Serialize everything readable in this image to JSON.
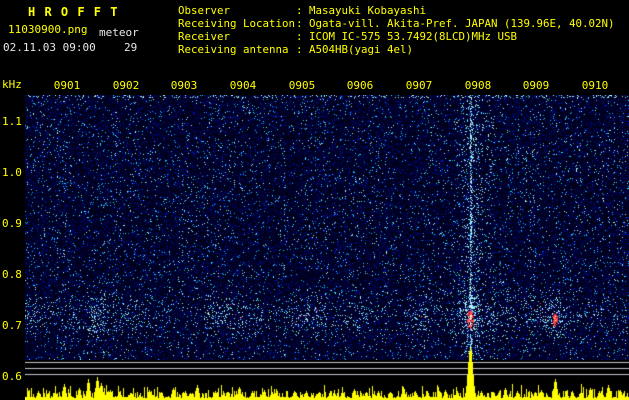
{
  "header": {
    "app_title": "H R O F F T",
    "filename": "11030900.png",
    "mode_label": "meteor",
    "datetime": "02.11.03 09:00",
    "echo_count": "29",
    "info": [
      {
        "label": "Observer",
        "value": ": Masayuki Kobayashi"
      },
      {
        "label": "Receiving Location",
        "value": ": Ogata-vill. Akita-Pref. JAPAN (139.96E, 40.02N)"
      },
      {
        "label": "Receiver",
        "value": ": ICOM IC-575 53.7492(8LCD)MHz USB"
      },
      {
        "label": "Receiving antenna",
        "value": ": A504HB(yagi 4el)"
      }
    ]
  },
  "axes": {
    "freq_labels": [
      "kHz",
      "1.1",
      "1.0",
      "0.9",
      "0.8",
      "0.7",
      "0.6"
    ],
    "time_labels": [
      "0901",
      "0902",
      "0903",
      "0904",
      "0905",
      "0906",
      "0907",
      "0908",
      "0909",
      "0910"
    ]
  },
  "chart_data": {
    "type": "heatmap",
    "subtype": "radio-meteor-spectrogram waterfall with amplitude strip below",
    "title": "HROFFT 10-minute meteor echo spectrogram, 02.11.03 09:00-09:10",
    "x_ticks": [
      "0901",
      "0902",
      "0903",
      "0904",
      "0905",
      "0906",
      "0907",
      "0908",
      "0909",
      "0910"
    ],
    "y_unit": "kHz",
    "y_ticks_khz": [
      1.1,
      1.0,
      0.9,
      0.8,
      0.7,
      0.6
    ],
    "y_range_khz": [
      0.6,
      1.16
    ],
    "echo_count": 29,
    "carrier_band_khz": 0.72,
    "meteor_echoes": [
      {
        "time": "~0901.6",
        "freq_khz": 0.72,
        "strength": "weak",
        "note": "small cyan cluster with faint red dots, small amplitude spike"
      },
      {
        "time": "~0908.0",
        "freq_khz": 0.72,
        "strength": "strong",
        "note": "overdense long echo: full-height cyan streak, saturated red/white core, large yellow amplitude spike"
      },
      {
        "time": "~0909.5",
        "freq_khz": 0.74,
        "strength": "moderate",
        "note": "cyan blob with red streak, medium amplitude spike"
      }
    ],
    "colors": {
      "background": "#000010",
      "noise_blue": "#0030a0",
      "speckle_cyan": "#00ccff",
      "hot_core": "#ff2050",
      "amplitude_spike": "#ffff00",
      "text_yellow": "#ffff00",
      "text_white": "#e8e8e8",
      "level_line": "#c0c4cc"
    }
  },
  "render": {
    "seed": 20021103,
    "band_y": 220,
    "level_lines": [
      17,
      23,
      29
    ],
    "events": [
      {
        "x_frac": 0.119,
        "blob": 0.7,
        "red": 0.5,
        "streak": false,
        "spike": 23
      },
      {
        "x_frac": 0.737,
        "blob": 1.0,
        "red": 1.0,
        "streak": true,
        "spike": 53
      },
      {
        "x_frac": 0.877,
        "blob": 0.85,
        "red": 0.75,
        "streak": false,
        "spike": 21
      }
    ],
    "minor_spikes": [
      [
        0.022,
        9
      ],
      [
        0.048,
        7
      ],
      [
        0.065,
        16
      ],
      [
        0.09,
        12
      ],
      [
        0.105,
        21
      ],
      [
        0.125,
        17
      ],
      [
        0.14,
        10
      ],
      [
        0.155,
        8
      ],
      [
        0.175,
        7
      ],
      [
        0.205,
        10
      ],
      [
        0.225,
        8
      ],
      [
        0.245,
        12
      ],
      [
        0.265,
        9
      ],
      [
        0.285,
        15
      ],
      [
        0.315,
        9
      ],
      [
        0.335,
        8
      ],
      [
        0.355,
        13
      ],
      [
        0.375,
        9
      ],
      [
        0.395,
        10
      ],
      [
        0.415,
        8
      ],
      [
        0.445,
        9
      ],
      [
        0.465,
        9
      ],
      [
        0.485,
        7
      ],
      [
        0.505,
        8
      ],
      [
        0.525,
        9
      ],
      [
        0.545,
        11
      ],
      [
        0.565,
        8
      ],
      [
        0.585,
        9
      ],
      [
        0.605,
        8
      ],
      [
        0.625,
        13
      ],
      [
        0.645,
        9
      ],
      [
        0.665,
        8
      ],
      [
        0.685,
        9
      ],
      [
        0.695,
        10
      ],
      [
        0.715,
        8
      ],
      [
        0.755,
        9
      ],
      [
        0.775,
        8
      ],
      [
        0.795,
        12
      ],
      [
        0.815,
        9
      ],
      [
        0.845,
        8
      ],
      [
        0.855,
        10
      ],
      [
        0.875,
        9
      ],
      [
        0.905,
        9
      ],
      [
        0.92,
        8
      ],
      [
        0.935,
        12
      ],
      [
        0.95,
        9
      ],
      [
        0.965,
        15
      ],
      [
        0.985,
        10
      ]
    ]
  }
}
